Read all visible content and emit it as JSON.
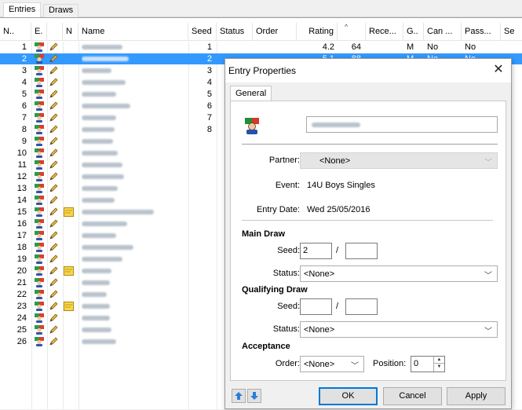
{
  "tabs": [
    {
      "label": "Entries",
      "active": true
    },
    {
      "label": "Draws",
      "active": false
    }
  ],
  "grid": {
    "columns": [
      "N..",
      "E.",
      "N",
      "Name",
      "Seed",
      "Status",
      "Order",
      "Rating",
      "",
      "Rece...",
      "G..",
      "Can ...",
      "Pass...",
      "Se"
    ],
    "sort_indicator": "^",
    "rows": [
      {
        "n": "1",
        "seed": "1",
        "rating": "4.2",
        "extra": "64",
        "g": "M",
        "can": "No",
        "pass": "No",
        "note": false
      },
      {
        "n": "2",
        "seed": "2",
        "rating": "5.1",
        "extra": "88",
        "g": "M",
        "can": "No",
        "pass": "No",
        "note": false,
        "selected": true
      },
      {
        "n": "3",
        "seed": "3",
        "note": false
      },
      {
        "n": "4",
        "seed": "4",
        "note": false
      },
      {
        "n": "5",
        "seed": "5",
        "note": false
      },
      {
        "n": "6",
        "seed": "6",
        "note": false
      },
      {
        "n": "7",
        "seed": "7",
        "note": false
      },
      {
        "n": "8",
        "seed": "8",
        "note": false
      },
      {
        "n": "9",
        "seed": "",
        "note": false
      },
      {
        "n": "10",
        "seed": "",
        "note": false
      },
      {
        "n": "11",
        "seed": "",
        "note": false
      },
      {
        "n": "12",
        "seed": "",
        "note": false
      },
      {
        "n": "13",
        "seed": "",
        "note": false
      },
      {
        "n": "14",
        "seed": "",
        "note": false
      },
      {
        "n": "15",
        "seed": "",
        "note": true
      },
      {
        "n": "16",
        "seed": "",
        "note": false
      },
      {
        "n": "17",
        "seed": "",
        "note": false
      },
      {
        "n": "18",
        "seed": "",
        "note": false
      },
      {
        "n": "19",
        "seed": "",
        "note": false
      },
      {
        "n": "20",
        "seed": "",
        "note": true
      },
      {
        "n": "21",
        "seed": "",
        "note": false
      },
      {
        "n": "22",
        "seed": "",
        "note": false
      },
      {
        "n": "23",
        "seed": "",
        "note": true
      },
      {
        "n": "24",
        "seed": "",
        "note": false
      },
      {
        "n": "25",
        "seed": "",
        "note": false
      },
      {
        "n": "26",
        "seed": "",
        "note": false
      }
    ]
  },
  "dialog": {
    "title": "Entry Properties",
    "close_glyph": "✕",
    "tab": "General",
    "partner_label": "Partner:",
    "partner_value": "<None>",
    "event_label": "Event:",
    "event_value": "14U Boys Singles",
    "entry_date_label": "Entry Date:",
    "entry_date_value": "Wed 25/05/2016",
    "main_draw_heading": "Main Draw",
    "main_seed_label": "Seed:",
    "main_seed_value": "2",
    "main_seed_total": "",
    "slash": "/",
    "main_status_label": "Status:",
    "main_status_value": "<None>",
    "qualifying_heading": "Qualifying Draw",
    "qual_seed_label": "Seed:",
    "qual_seed_value": "",
    "qual_seed_total": "",
    "qual_status_label": "Status:",
    "qual_status_value": "<None>",
    "acceptance_heading": "Acceptance",
    "order_label": "Order:",
    "order_value": "<None>",
    "position_label": "Position:",
    "position_value": "0",
    "ok_label": "OK",
    "cancel_label": "Cancel",
    "apply_label": "Apply",
    "up_glyph": "🡅",
    "down_glyph": "🡇"
  },
  "colors": {
    "selection": "#3399ff",
    "default_button_border": "#0078d7"
  },
  "icons": [
    "player-icon",
    "pencil-icon",
    "note-icon",
    "close-icon",
    "chevron-down-icon",
    "arrow-up-icon",
    "arrow-down-icon",
    "spin-up-icon",
    "spin-down-icon"
  ]
}
